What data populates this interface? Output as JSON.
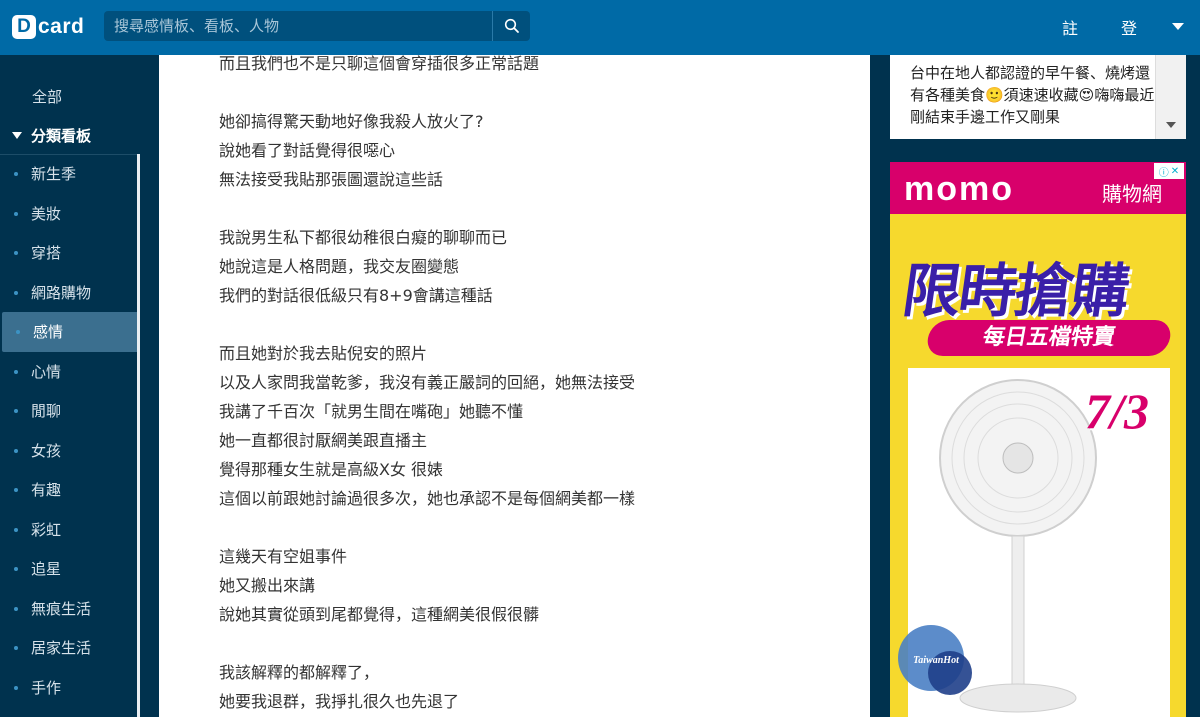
{
  "header": {
    "logo_letter": "D",
    "logo_text": "card",
    "search_placeholder": "搜尋感情板、看板、人物",
    "register": "註",
    "login": "登"
  },
  "sidebar": {
    "all": "全部",
    "category_header": "分類看板",
    "items": [
      {
        "label": "新生季"
      },
      {
        "label": "美妝"
      },
      {
        "label": "穿搭"
      },
      {
        "label": "網路購物"
      },
      {
        "label": "感情"
      },
      {
        "label": "心情"
      },
      {
        "label": "閒聊"
      },
      {
        "label": "女孩"
      },
      {
        "label": "有趣"
      },
      {
        "label": "彩虹"
      },
      {
        "label": "追星"
      },
      {
        "label": "無痕生活"
      },
      {
        "label": "居家生活"
      },
      {
        "label": "手作"
      }
    ]
  },
  "article": {
    "lines": [
      "而且我們也不是只聊這個會穿插很多正常話題",
      "",
      "她卻搞得驚天動地好像我殺人放火了?",
      "說她看了對話覺得很噁心",
      "無法接受我貼那張圖還說這些話",
      "",
      "我說男生私下都很幼稚很白癡的聊聊而已",
      "她說這是人格問題，我交友圈變態",
      "我們的對話很低級只有8+9會講這種話",
      "",
      "而且她對於我去貼倪安的照片",
      "以及人家問我當乾爹，我沒有義正嚴詞的回絕，她無法接受",
      "我講了千百次「就男生間在嘴砲」她聽不懂",
      "她一直都很討厭網美跟直播主",
      "覺得那種女生就是高級X女 很婊",
      "這個以前跟她討論過很多次，她也承認不是每個網美都一樣",
      "",
      "這幾天有空姐事件",
      "她又搬出來講",
      "說她其實從頭到尾都覺得，這種網美很假很髒",
      "",
      "我該解釋的都解釋了，",
      "她要我退群，我掙扎很久也先退了"
    ]
  },
  "right_column": {
    "recommend_text": "台中在地人都認證的早午餐、燒烤還有各種美食🙂須速速收藏😍嗨嗨最近剛結束手邊工作又剛果"
  },
  "ad": {
    "brand": "momo",
    "brand_suffix": "購物網",
    "headline": "限時搶購",
    "ribbon": "每日五檔特賣",
    "date": "7/3"
  },
  "watermark": {
    "label": "TaiwanHot"
  },
  "colors": {
    "header_bg": "#006aa6",
    "sidebar_bg": "#00324e",
    "active_item_bg": "#3b6f8f",
    "ad_pink": "#d8006b",
    "ad_yellow": "#f6d92d"
  }
}
